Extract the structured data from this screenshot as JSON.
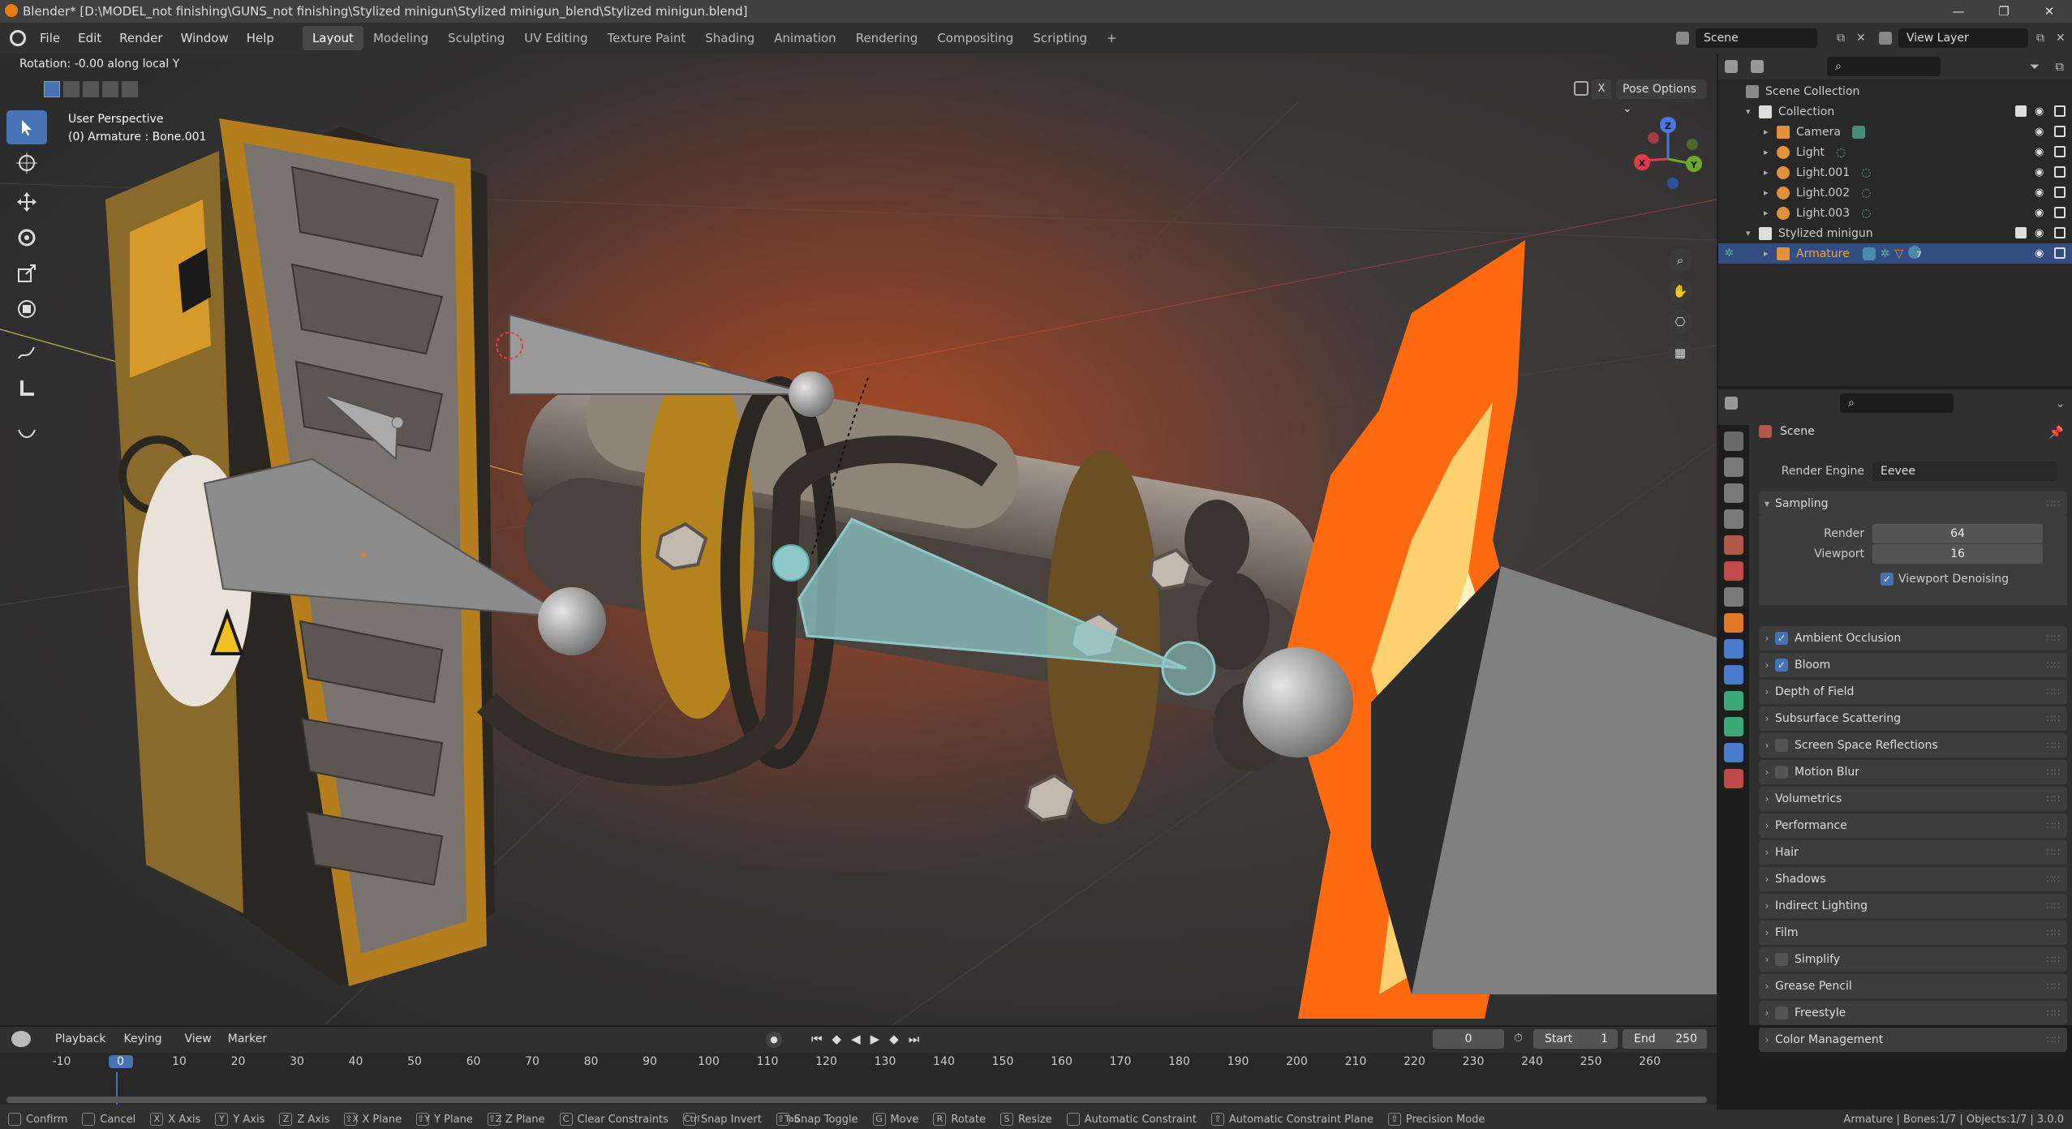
{
  "window": {
    "title": "Blender* [D:\\MODEL_not finishing\\GUNS_not finishing\\Stylized minigun\\Stylized minigun_blend\\Stylized minigun.blend]"
  },
  "menu": [
    "File",
    "Edit",
    "Render",
    "Window",
    "Help"
  ],
  "workspaces": [
    "Layout",
    "Modeling",
    "Sculpting",
    "UV Editing",
    "Texture Paint",
    "Shading",
    "Animation",
    "Rendering",
    "Compositing",
    "Scripting"
  ],
  "scene": {
    "name": "Scene",
    "view_layer": "View Layer"
  },
  "viewport": {
    "header_text": "Rotation: -0.00 along local Y",
    "perspective": "User Perspective",
    "object_info": "(0) Armature : Bone.001",
    "pose_options": "Pose Options",
    "x_label": "X"
  },
  "gizmo": {
    "x": "X",
    "y": "Y",
    "z": "Z"
  },
  "outliner": {
    "root": "Scene Collection",
    "items": [
      {
        "label": "Collection",
        "level": 1
      },
      {
        "label": "Camera",
        "level": 2
      },
      {
        "label": "Light",
        "level": 2
      },
      {
        "label": "Light.001",
        "level": 2
      },
      {
        "label": "Light.002",
        "level": 2
      },
      {
        "label": "Light.003",
        "level": 2
      },
      {
        "label": "Stylized minigun",
        "level": 1
      },
      {
        "label": "Armature",
        "level": 2,
        "selected": true
      }
    ],
    "armature_badge": "7"
  },
  "properties": {
    "context": "Scene",
    "render_engine_label": "Render Engine",
    "render_engine": "Eevee",
    "sampling": {
      "title": "Sampling",
      "render_label": "Render",
      "render": "64",
      "viewport_label": "Viewport",
      "viewport": "16",
      "denoise": "Viewport Denoising"
    },
    "panels": [
      {
        "label": "Ambient Occlusion",
        "checkbox": true,
        "checked": true
      },
      {
        "label": "Bloom",
        "checkbox": true,
        "checked": true
      },
      {
        "label": "Depth of Field",
        "checkbox": false
      },
      {
        "label": "Subsurface Scattering",
        "checkbox": false
      },
      {
        "label": "Screen Space Reflections",
        "checkbox": true,
        "checked": false
      },
      {
        "label": "Motion Blur",
        "checkbox": true,
        "checked": false
      },
      {
        "label": "Volumetrics",
        "checkbox": false
      },
      {
        "label": "Performance",
        "checkbox": false
      },
      {
        "label": "Hair",
        "checkbox": false
      },
      {
        "label": "Shadows",
        "checkbox": false
      },
      {
        "label": "Indirect Lighting",
        "checkbox": false
      },
      {
        "label": "Film",
        "checkbox": false
      },
      {
        "label": "Simplify",
        "checkbox": true,
        "checked": false
      },
      {
        "label": "Grease Pencil",
        "checkbox": false
      },
      {
        "label": "Freestyle",
        "checkbox": true,
        "checked": false
      },
      {
        "label": "Color Management",
        "checkbox": false
      }
    ]
  },
  "timeline": {
    "menus": [
      "Playback",
      "Keying",
      "View",
      "Marker"
    ],
    "current_frame": "0",
    "start_label": "Start",
    "start": "1",
    "end_label": "End",
    "end": "250",
    "ticks": [
      "-10",
      "0",
      "10",
      "20",
      "30",
      "40",
      "50",
      "60",
      "70",
      "80",
      "90",
      "100",
      "110",
      "120",
      "130",
      "140",
      "150",
      "160",
      "170",
      "180",
      "190",
      "200",
      "210",
      "220",
      "230",
      "240",
      "250",
      "260"
    ]
  },
  "statusbar": {
    "items": [
      {
        "key": "",
        "label": "Confirm"
      },
      {
        "key": "",
        "label": "Cancel"
      },
      {
        "key": "X",
        "label": "X Axis"
      },
      {
        "key": "Y",
        "label": "Y Axis"
      },
      {
        "key": "Z",
        "label": "Z Axis"
      },
      {
        "key": "⇧X",
        "label": "X Plane"
      },
      {
        "key": "⇧Y",
        "label": "Y Plane"
      },
      {
        "key": "⇧Z",
        "label": "Z Plane"
      },
      {
        "key": "C",
        "label": "Clear Constraints"
      },
      {
        "key": "Ctrl",
        "label": "Snap Invert"
      },
      {
        "key": "⇧Tab",
        "label": "Snap Toggle"
      },
      {
        "key": "G",
        "label": "Move"
      },
      {
        "key": "R",
        "label": "Rotate"
      },
      {
        "key": "S",
        "label": "Resize"
      },
      {
        "key": "",
        "label": "Automatic Constraint"
      },
      {
        "key": "⇧",
        "label": "Automatic Constraint Plane"
      },
      {
        "key": "⇧",
        "label": "Precision Mode"
      }
    ],
    "stats": "Armature | Bones:1/7 | Objects:1/7 | 3.0.0"
  },
  "colors": {
    "accent": "#4772b3",
    "bone_selected": "#8ec8c8",
    "fire": "#ff6a00"
  }
}
